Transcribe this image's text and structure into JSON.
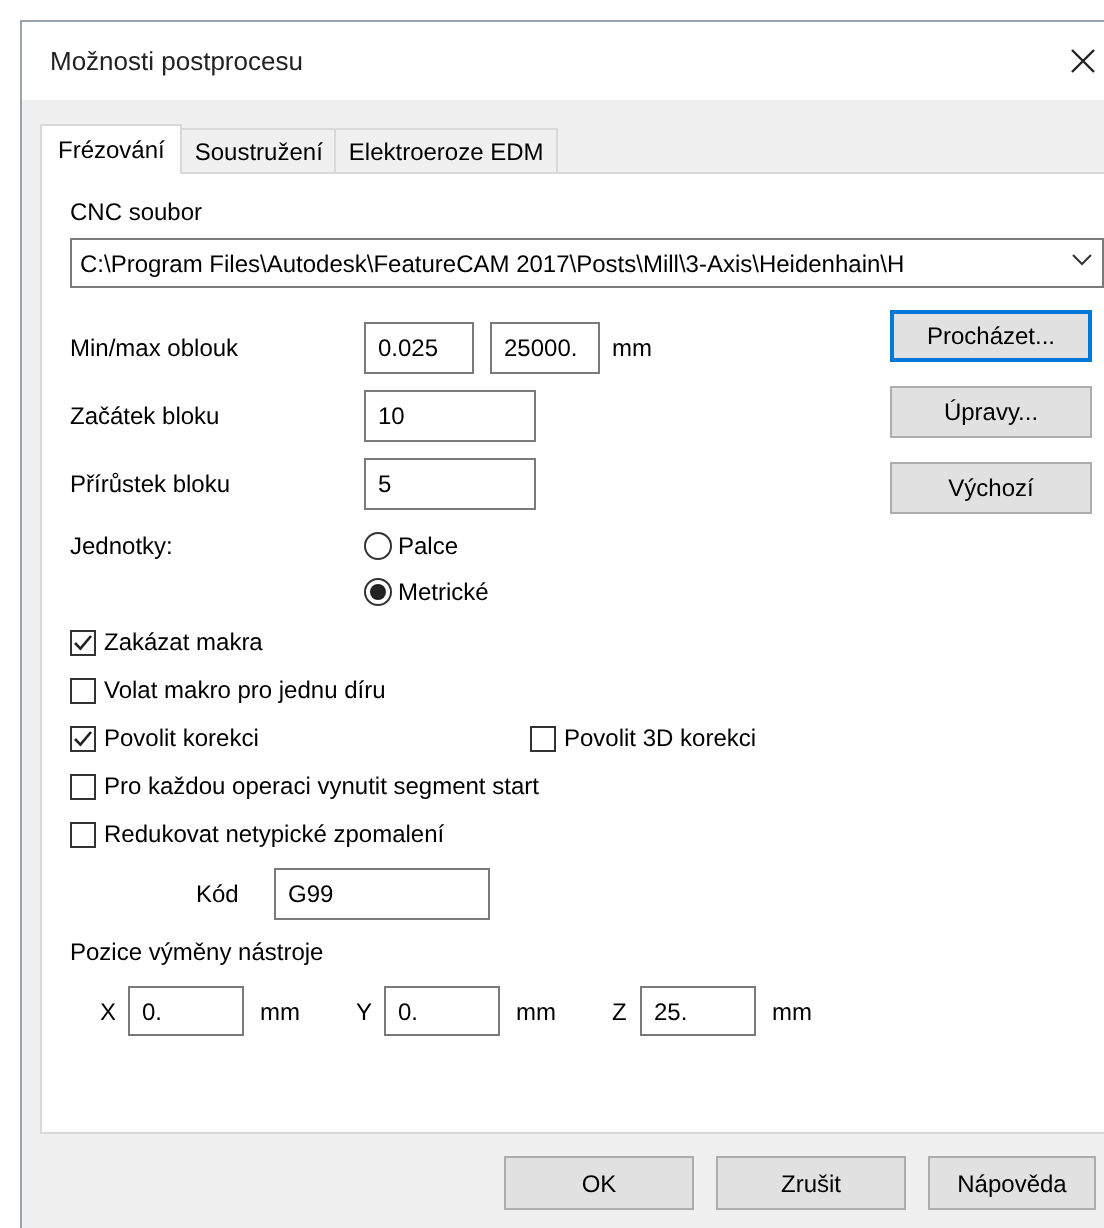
{
  "window": {
    "title": "Možnosti postprocesu"
  },
  "tabs": [
    {
      "label": "Frézování",
      "selected": true
    },
    {
      "label": "Soustružení",
      "selected": false
    },
    {
      "label": "Elektroeroze EDM",
      "selected": false
    }
  ],
  "cnc_file": {
    "label": "CNC soubor",
    "value": "C:\\Program Files\\Autodesk\\FeatureCAM 2017\\Posts\\Mill\\3-Axis\\Heidenhain\\H"
  },
  "min_max_arc": {
    "label": "Min/max oblouk",
    "values": [
      "0.025",
      "25000."
    ],
    "unit": "mm"
  },
  "block_start": {
    "label": "Začátek bloku",
    "value": "10"
  },
  "block_increment": {
    "label": "Přírůstek bloku",
    "value": "5"
  },
  "units": {
    "label": "Jednotky:",
    "options": [
      {
        "label": "Palce",
        "selected": false
      },
      {
        "label": "Metrické",
        "selected": true
      }
    ]
  },
  "side_buttons": [
    {
      "label": "Procházet...",
      "focused": true
    },
    {
      "label": "Úpravy...",
      "focused": false
    },
    {
      "label": "Výchozí",
      "focused": false
    }
  ],
  "checkbox_rows": [
    {
      "items": [
        {
          "label": "Zakázat makra",
          "checked": true
        }
      ]
    },
    {
      "items": [
        {
          "label": "Volat makro pro jednu díru",
          "checked": false
        }
      ]
    },
    {
      "items": [
        {
          "label": "Povolit korekci",
          "checked": true
        },
        {
          "label": "Povolit 3D korekci",
          "checked": false
        }
      ]
    },
    {
      "items": [
        {
          "label": "Pro každou operaci vynutit segment start",
          "checked": false
        }
      ]
    },
    {
      "items": [
        {
          "label": "Redukovat netypické zpomalení",
          "checked": false
        }
      ]
    }
  ],
  "code": {
    "label": "Kód",
    "value": "G99"
  },
  "tool_change": {
    "label": "Pozice výměny nástroje",
    "axes": [
      {
        "axis": "X",
        "value": "0.",
        "unit": "mm"
      },
      {
        "axis": "Y",
        "value": "0.",
        "unit": "mm"
      },
      {
        "axis": "Z",
        "value": "25.",
        "unit": "mm"
      }
    ]
  },
  "buttons": [
    "OK",
    "Zrušit",
    "Nápověda"
  ]
}
